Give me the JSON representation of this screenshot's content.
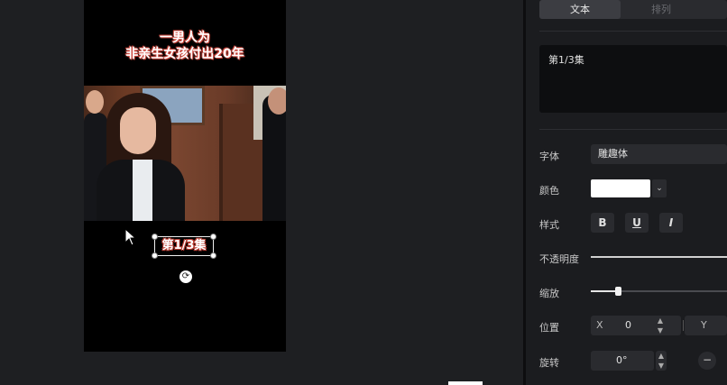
{
  "preview": {
    "title_line1": "一男人为",
    "title_line2": "非亲生女孩付出20年",
    "caption": "第1/3集",
    "rotate_glyph": "⟳"
  },
  "panel": {
    "tabs": [
      {
        "label": "文本",
        "active": true
      },
      {
        "label": "排列",
        "active": false
      }
    ],
    "text_value": "第1/3集",
    "font_label": "字体",
    "font_value": "雕趣体",
    "color_label": "颜色",
    "color_value": "#ffffff",
    "color_dropdown_glyph": "⌄",
    "style_label": "样式",
    "style_buttons": {
      "bold": "B",
      "underline": "U",
      "italic": "I"
    },
    "opacity_label": "不透明度",
    "opacity": 1.0,
    "scale_label": "缩放",
    "scale": 0.2,
    "position_label": "位置",
    "position_x_label": "X",
    "position_x_value": "0",
    "position_y_label": "Y",
    "stepper_glyph": "⌃⌄",
    "rotation_label": "旋转",
    "rotation_value": "0°",
    "rotation_knob_glyph": "−"
  },
  "colors": {
    "accent_active_tab": "#3c3d42",
    "background": "#1c1d20",
    "caption_stroke": "#b8392f"
  }
}
